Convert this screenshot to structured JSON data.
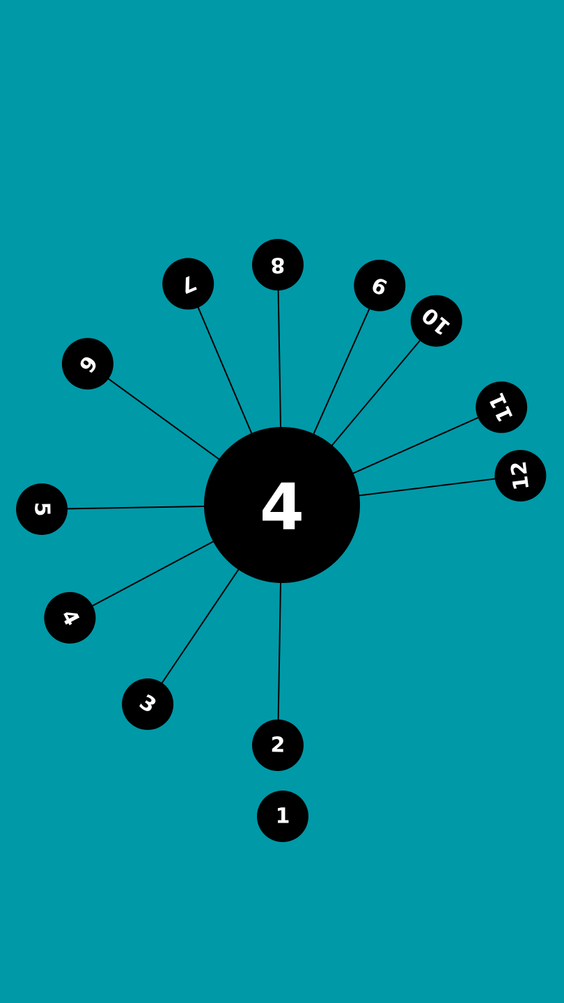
{
  "colors": {
    "background": "#0099a8",
    "ball": "#000000",
    "text": "#ffffff",
    "line": "#000000"
  },
  "level": "4",
  "attached_pins": [
    {
      "label": "2"
    },
    {
      "label": "3"
    },
    {
      "label": "4"
    },
    {
      "label": "5"
    },
    {
      "label": "6"
    },
    {
      "label": "7"
    },
    {
      "label": "8"
    },
    {
      "label": "9"
    },
    {
      "label": "10"
    },
    {
      "label": "11"
    },
    {
      "label": "12"
    }
  ],
  "queued_pins": [
    {
      "label": "1"
    }
  ]
}
